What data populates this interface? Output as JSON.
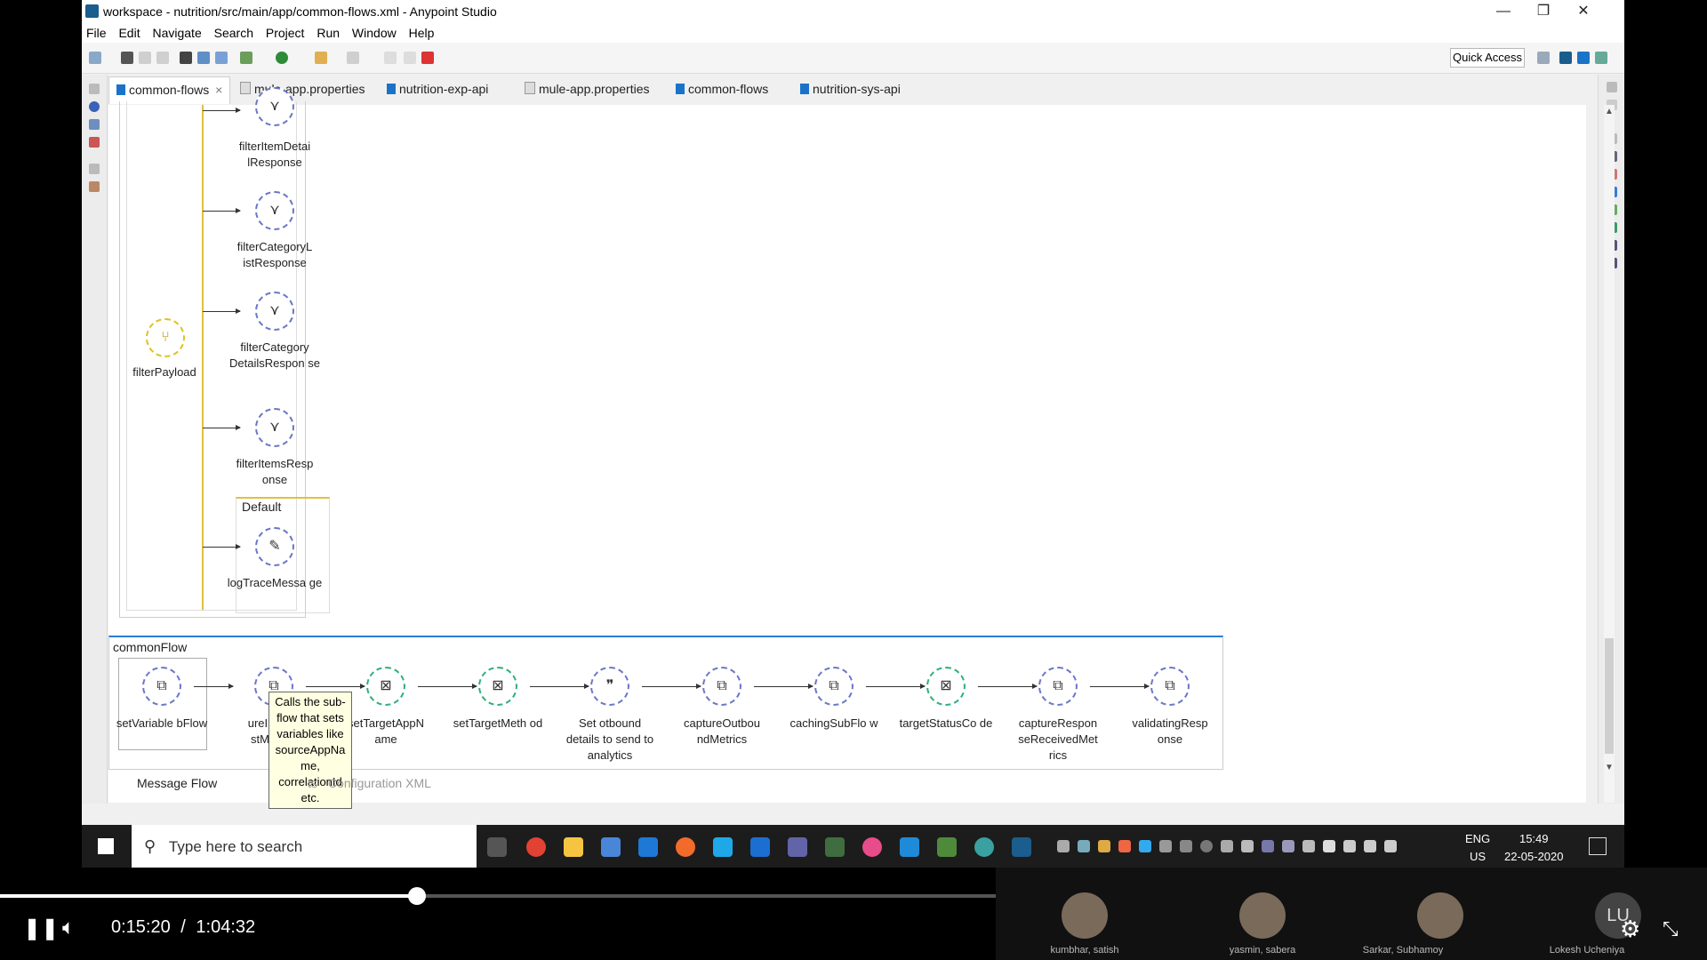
{
  "window": {
    "title": "workspace - nutrition/src/main/app/common-flows.xml - Anypoint Studio",
    "minimize": "—",
    "restore": "❐",
    "close": "✕"
  },
  "menu": [
    "File",
    "Edit",
    "Navigate",
    "Search",
    "Project",
    "Run",
    "Window",
    "Help"
  ],
  "toolbar": {
    "quick_access": "Quick Access"
  },
  "tabs": [
    {
      "label": "common-flows",
      "close": "×",
      "active": true
    },
    {
      "label": "mule-app.properties"
    },
    {
      "label": "nutrition-exp-api"
    },
    {
      "label": "mule-app.properties"
    },
    {
      "label": "common-flows"
    },
    {
      "label": "nutrition-sys-api"
    }
  ],
  "choice_flow": {
    "router": "filterPayload",
    "routes": [
      "filterItemDetai lResponse",
      "filterCategoryL istResponse",
      "filterCategory DetailsRespon se",
      "filterItemsResp onse"
    ],
    "default_label": "Default",
    "default_route": "logTraceMessa ge"
  },
  "common_flow": {
    "title": "commonFlow",
    "steps": [
      {
        "label": "setVariable bFlow",
        "kind": "flow-ref"
      },
      {
        "label": "ureInitialR stMetrics",
        "kind": "flow-ref"
      },
      {
        "label": "setTargetAppN ame",
        "kind": "variable"
      },
      {
        "label": "setTargetMeth od",
        "kind": "variable"
      },
      {
        "label": "Set otbound details to send to analytics",
        "kind": "set-payload"
      },
      {
        "label": "captureOutbou ndMetrics",
        "kind": "flow-ref"
      },
      {
        "label": "cachingSubFlo w",
        "kind": "flow-ref"
      },
      {
        "label": "targetStatusCo de",
        "kind": "variable"
      },
      {
        "label": "captureRespon seReceivedMet rics",
        "kind": "flow-ref"
      },
      {
        "label": "validatingResp onse",
        "kind": "flow-ref"
      }
    ]
  },
  "tooltip": "Calls the sub-flow that sets variables like sourceAppNa me, correlationId etc.",
  "editor_tabs": {
    "message_flow": "Message Flow",
    "global_elements_partial": "ts",
    "configuration_xml": "Configuration XML"
  },
  "taskbar": {
    "search_placeholder": "Type here to search",
    "lang_1": "ENG",
    "lang_2": "US",
    "time": "15:49",
    "date": "22-05-2020"
  },
  "player": {
    "current": "0:15:20",
    "separator": "/",
    "duration": "1:04:32",
    "progress_fraction": 0.2445
  },
  "participants": [
    {
      "name": "kumbhar, satish"
    },
    {
      "name": "yasmin, sabera"
    },
    {
      "name": "Sarkar, Subhamoy"
    },
    {
      "name": "Lokesh Ucheniya",
      "initials": "LU"
    }
  ]
}
